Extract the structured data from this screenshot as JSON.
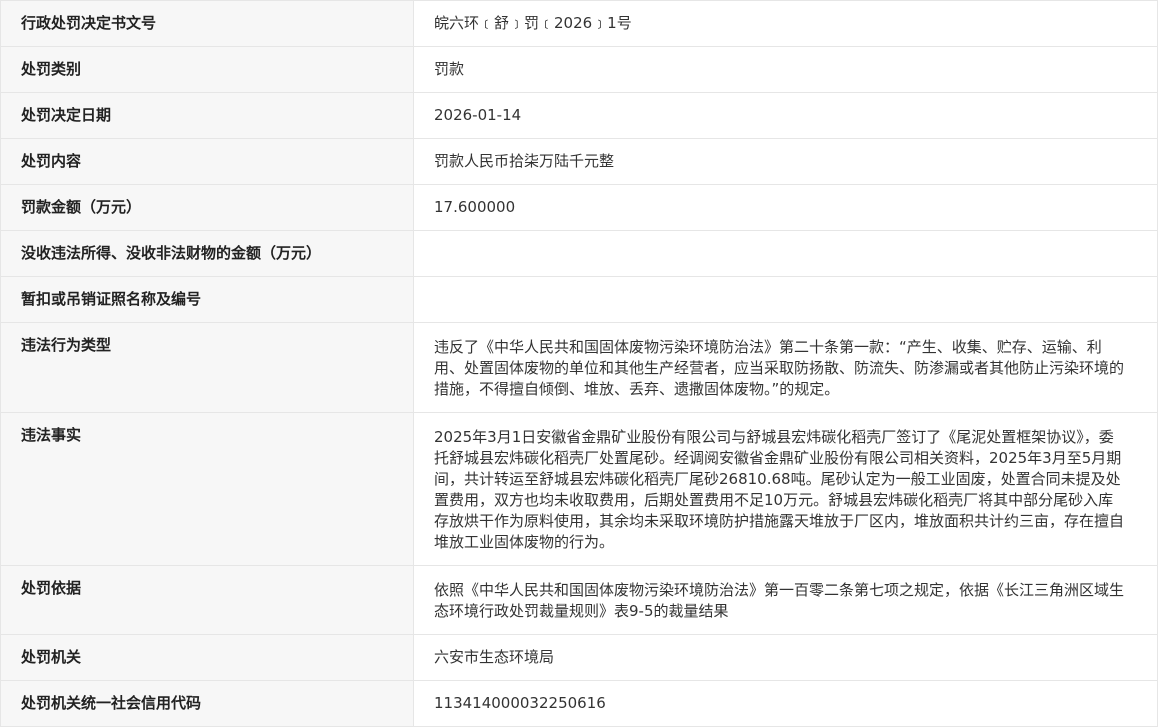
{
  "rows": [
    {
      "label": "行政处罚决定书文号",
      "value": "皖六环﹝舒﹞罚﹝2026﹞1号"
    },
    {
      "label": "处罚类别",
      "value": "罚款"
    },
    {
      "label": "处罚决定日期",
      "value": "2026-01-14"
    },
    {
      "label": "处罚内容",
      "value": "罚款人民币拾柒万陆千元整"
    },
    {
      "label": "罚款金额（万元）",
      "value": "17.600000"
    },
    {
      "label": "没收违法所得、没收非法财物的金额（万元）",
      "value": ""
    },
    {
      "label": "暂扣或吊销证照名称及编号",
      "value": ""
    },
    {
      "label": "违法行为类型",
      "value": "违反了《中华人民共和国固体废物污染环境防治法》第二十条第一款：“产生、收集、贮存、运输、利用、处置固体废物的单位和其他生产经营者，应当采取防扬散、防流失、防渗漏或者其他防止污染环境的措施，不得擅自倾倒、堆放、丢弃、遗撒固体废物。”的规定。"
    },
    {
      "label": "违法事实",
      "value": "2025年3月1日安徽省金鼎矿业股份有限公司与舒城县宏炜碳化稻壳厂签订了《尾泥处置框架协议》，委托舒城县宏炜碳化稻壳厂处置尾砂。经调阅安徽省金鼎矿业股份有限公司相关资料，2025年3月至5月期间，共计转运至舒城县宏炜碳化稻壳厂尾砂26810.68吨。尾砂认定为一般工业固废，处置合同未提及处置费用，双方也均未收取费用，后期处置费用不足10万元。舒城县宏炜碳化稻壳厂将其中部分尾砂入库存放烘干作为原料使用，其余均未采取环境防护措施露天堆放于厂区内，堆放面积共计约三亩，存在擅自堆放工业固体废物的行为。"
    },
    {
      "label": "处罚依据",
      "value": "依照《中华人民共和国固体废物污染环境防治法》第一百零二条第七项之规定，依据《长江三角洲区域生态环境行政处罚裁量规则》表9-5的裁量结果"
    },
    {
      "label": "处罚机关",
      "value": "六安市生态环境局"
    },
    {
      "label": "处罚机关统一社会信用代码",
      "value": "11341400003225061​6"
    }
  ]
}
